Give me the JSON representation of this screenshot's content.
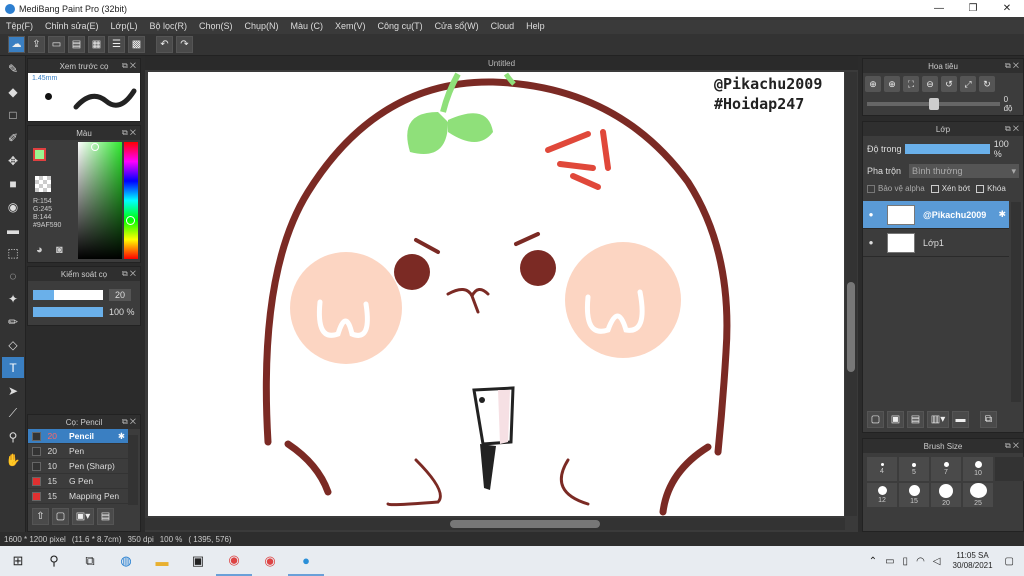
{
  "window": {
    "title": "MediBang Paint Pro (32bit)",
    "minimize": "—",
    "maximize": "❐",
    "close": "✕"
  },
  "menu": [
    "Tệp(F)",
    "Chỉnh sửa(E)",
    "Lớp(L)",
    "Bộ lọc(R)",
    "Chọn(S)",
    "Chụp(N)",
    "Màu (C)",
    "Xem(V)",
    "Công cụ(T)",
    "Cửa sổ(W)",
    "Cloud",
    "Help"
  ],
  "canvas": {
    "tab": "Untitled",
    "watermark1": "@Pikachu2009",
    "watermark2": "#Hoidap247"
  },
  "brush_preview": {
    "title": "Xem trước cọ",
    "size": "1.45mm"
  },
  "color_panel": {
    "title": "Màu",
    "r": "R:154",
    "g": "G:245",
    "b": "B:144",
    "hex": "#9AF590",
    "current": "#9AF590"
  },
  "brush_control": {
    "title": "Kiểm soát cọ",
    "size": "20",
    "opacity": "100 %",
    "size_fill": 0.3,
    "opacity_fill": 1.0
  },
  "brush_list": {
    "title": "Cọ: Pencil",
    "items": [
      {
        "size": "20",
        "name": "Pencil",
        "color": "#333333"
      },
      {
        "size": "20",
        "name": "Pen",
        "color": "#333333"
      },
      {
        "size": "10",
        "name": "Pen (Sharp)",
        "color": "#333333"
      },
      {
        "size": "15",
        "name": "G Pen",
        "color": "#e03030"
      },
      {
        "size": "15",
        "name": "Mapping Pen",
        "color": "#e03030"
      }
    ]
  },
  "navigator": {
    "title": "Hoa tiêu",
    "angle": "0 độ"
  },
  "layer_panel": {
    "title": "Lớp",
    "opacity_label": "Độ trong",
    "opacity": "100 %",
    "blend_label": "Pha trộn",
    "blend": "Bình thường",
    "protect_alpha": "Bảo vệ alpha",
    "clipping": "Xén bớt",
    "lock": "Khóa",
    "layers": [
      {
        "name": "@Pikachu2009"
      },
      {
        "name": "Lớp1"
      }
    ]
  },
  "brush_size": {
    "title": "Brush Size",
    "sizes": [
      "4",
      "5",
      "7",
      "10",
      "12",
      "15",
      "20",
      "25"
    ]
  },
  "status": {
    "dims": "1600 * 1200 pixel",
    "physical": "(11.6 * 8.7cm)",
    "dpi": "350 dpi",
    "zoom": "100 %",
    "coords": "( 1395, 576)"
  },
  "taskbar": {
    "time": "11:05 SA",
    "date": "30/08/2021"
  }
}
